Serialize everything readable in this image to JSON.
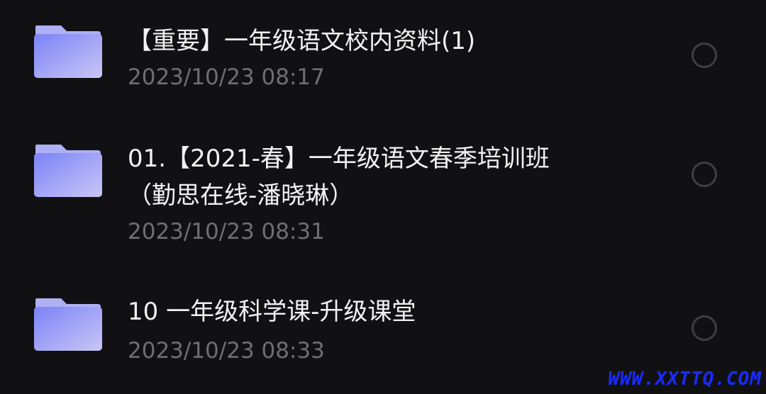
{
  "files": [
    {
      "icon": "folder-icon",
      "title_lines": [
        "【重要】一年级语文校内资料(1)"
      ],
      "date": "2023/10/23 08:17"
    },
    {
      "icon": "folder-icon",
      "title_lines": [
        "01.【2021-春】一年级语文春季培训班",
        "（勤思在线-潘晓琳）"
      ],
      "date": "2023/10/23 08:31"
    },
    {
      "icon": "folder-icon",
      "title_lines": [
        "10 一年级科学课-升级课堂"
      ],
      "date": "2023/10/23 08:33"
    }
  ],
  "watermark": "WWW.XXTTQ.COM",
  "colors": {
    "background": "#111113",
    "title": "#f2f2f2",
    "date": "#6f6f73",
    "folder_light": "#b9b8f5",
    "folder_main": "#8c8ff7",
    "radio_border": "#3e3e44",
    "watermark": "#1a2cff"
  }
}
